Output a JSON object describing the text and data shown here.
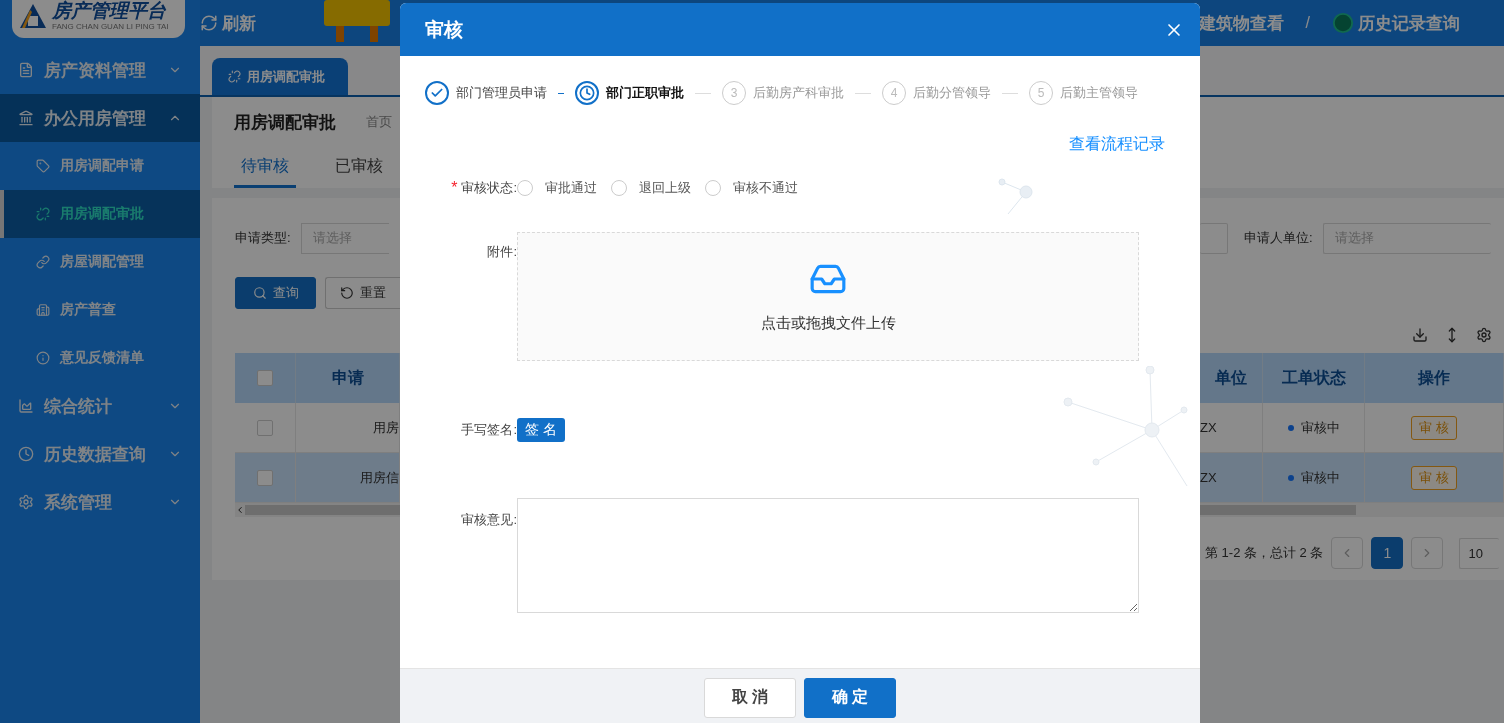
{
  "topbar": {
    "logo": {
      "title": "房产管理平台",
      "subtitle": "FANG CHAN GUAN LI PING TAI"
    },
    "refresh": "刷新",
    "nav": [
      {
        "label": "建筑物查看"
      },
      {
        "label": "历史记录查询"
      }
    ],
    "separator": "/"
  },
  "sidebar": {
    "items": [
      {
        "label": "房产资料管理",
        "expanded": false
      },
      {
        "label": "办公用房管理",
        "expanded": true,
        "children": [
          {
            "label": "用房调配申请",
            "selected": false
          },
          {
            "label": "用房调配审批",
            "selected": true
          },
          {
            "label": "房屋调配管理",
            "selected": false
          },
          {
            "label": "房产普查",
            "selected": false
          },
          {
            "label": "意见反馈清单",
            "selected": false
          }
        ]
      },
      {
        "label": "综合统计",
        "expanded": false
      },
      {
        "label": "历史数据查询",
        "expanded": false
      },
      {
        "label": "系统管理",
        "expanded": false
      }
    ]
  },
  "page_tabs": [
    {
      "label": "用房调配审批",
      "selected": true
    }
  ],
  "header": {
    "title": "用房调配审批",
    "breadcrumb": "首页",
    "tabs": [
      {
        "label": "待审核",
        "selected": true
      },
      {
        "label": "已审核",
        "selected": false
      }
    ]
  },
  "filters": [
    {
      "label": "申请类型:",
      "placeholder": "请选择"
    },
    {
      "label": "申请人单位:",
      "placeholder": "请选择"
    }
  ],
  "buttons": [
    {
      "label": "查询",
      "kind": "primary"
    },
    {
      "label": "重置",
      "kind": "default"
    }
  ],
  "table": {
    "header_checked": false,
    "columns": [
      "申请",
      "单位",
      "工单状态",
      "操作"
    ],
    "rows": [
      {
        "checked": false,
        "selected": false,
        "type": "用房",
        "unit": "ZX",
        "status": "审核中",
        "action": "审 核"
      },
      {
        "checked": false,
        "selected": true,
        "type": "用房信",
        "unit": "ZX",
        "status": "审核中",
        "action": "审 核"
      }
    ]
  },
  "pagination": {
    "summary": "第 1-2 条，总计 2 条",
    "pages": [
      {
        "label": "1",
        "selected": true
      }
    ],
    "page_size": "10"
  },
  "modal": {
    "title": "审核",
    "steps": [
      {
        "label": "部门管理员申请",
        "done": true,
        "active": false
      },
      {
        "label": "部门正职审批",
        "done": false,
        "active": true
      },
      {
        "label": "后勤房产科审批",
        "done": false,
        "active": false,
        "number": "3"
      },
      {
        "label": "后勤分管领导",
        "done": false,
        "active": false,
        "number": "4"
      },
      {
        "label": "后勤主管领导",
        "done": false,
        "active": false,
        "number": "5"
      }
    ],
    "link": "查看流程记录",
    "status_field": {
      "label": "审核状态:",
      "required_mark": "*",
      "options": [
        {
          "label": "审批通过",
          "selected": false
        },
        {
          "label": "退回上级",
          "selected": false
        },
        {
          "label": "审核不通过",
          "selected": false
        }
      ]
    },
    "attachment": {
      "label": "附件:",
      "hint": "点击或拖拽文件上传"
    },
    "signature": {
      "label": "手写签名:",
      "button": "签 名"
    },
    "comment": {
      "label": "审核意见:"
    },
    "buttons": [
      {
        "label": "取 消",
        "kind": "default"
      },
      {
        "label": "确 定",
        "kind": "primary"
      }
    ]
  }
}
